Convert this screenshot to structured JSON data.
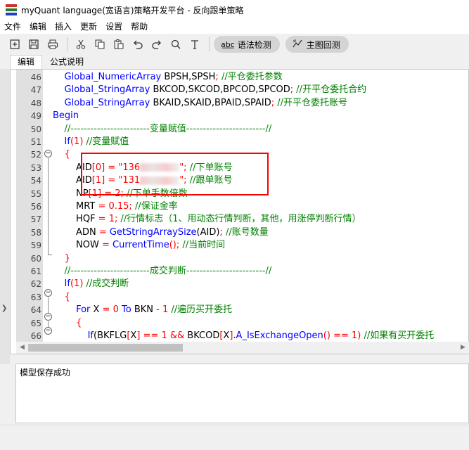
{
  "window": {
    "title": "myQuant language(宽语言)策略开发平台 - 反向跟单策略",
    "logo_colors": [
      "#d03030",
      "#2d7a2d",
      "#2040c0"
    ]
  },
  "menu": [
    "文件",
    "编辑",
    "插入",
    "更新",
    "设置",
    "帮助"
  ],
  "toolbar": {
    "icons": [
      "new-file-icon",
      "save-icon",
      "print-icon",
      "cut-icon",
      "copy-icon",
      "paste-icon",
      "undo-icon",
      "redo-icon",
      "search-icon",
      "text-icon"
    ],
    "syntax_check_label": "语法检测",
    "backtest_label": "主图回测"
  },
  "tabs": [
    "编辑",
    "公式说明"
  ],
  "code_lines": [
    {
      "n": "46",
      "segs": [
        [
          "    ",
          "tx"
        ],
        [
          "Global_NumericArray",
          "fn"
        ],
        [
          " BPSH,SPSH",
          "tx"
        ],
        [
          ";",
          "op"
        ],
        [
          " //平仓委托参数",
          "cm"
        ]
      ]
    },
    {
      "n": "47",
      "segs": [
        [
          "    ",
          "tx"
        ],
        [
          "Global_StringArray",
          "fn"
        ],
        [
          " BKCOD,SKCOD,BPCOD,SPCOD",
          "tx"
        ],
        [
          ";",
          "op"
        ],
        [
          " //开平仓委托合约",
          "cm"
        ]
      ]
    },
    {
      "n": "48",
      "segs": [
        [
          "    ",
          "tx"
        ],
        [
          "Global_StringArray",
          "fn"
        ],
        [
          " BKAID,SKAID,BPAID,SPAID",
          "tx"
        ],
        [
          ";",
          "op"
        ],
        [
          " //开平仓委托账号",
          "cm"
        ]
      ]
    },
    {
      "n": "49",
      "segs": [
        [
          "Begin",
          "kw"
        ]
      ]
    },
    {
      "n": "50",
      "segs": [
        [
          "    //------------------------变量赋值------------------------//",
          "cm"
        ]
      ]
    },
    {
      "n": "51",
      "segs": [
        [
          "    ",
          "tx"
        ],
        [
          "If",
          "kw"
        ],
        [
          "(",
          "op"
        ],
        [
          "1",
          "num"
        ],
        [
          ")",
          "op"
        ],
        [
          " //变量赋值",
          "cm"
        ]
      ]
    },
    {
      "n": "52",
      "segs": [
        [
          "    ",
          "tx"
        ],
        [
          "{",
          "op"
        ]
      ]
    },
    {
      "n": "53",
      "segs": [
        [
          "        AID",
          "tx"
        ],
        [
          "[",
          "op"
        ],
        [
          "0",
          "num"
        ],
        [
          "]",
          "op"
        ],
        [
          " = ",
          "op"
        ],
        [
          "\"136",
          "str"
        ],
        [
          "BLUR",
          "blur"
        ],
        [
          "\";",
          "str"
        ],
        [
          " //下单账号",
          "cm"
        ]
      ]
    },
    {
      "n": "54",
      "segs": [
        [
          "        AID",
          "tx"
        ],
        [
          "[",
          "op"
        ],
        [
          "1",
          "num"
        ],
        [
          "]",
          "op"
        ],
        [
          " = ",
          "op"
        ],
        [
          "\"131",
          "str"
        ],
        [
          "BLUR",
          "blur"
        ],
        [
          "\";",
          "str"
        ],
        [
          " //跟单账号",
          "cm"
        ]
      ]
    },
    {
      "n": "55",
      "segs": [
        [
          "        NP",
          "tx"
        ],
        [
          "[",
          "op"
        ],
        [
          "1",
          "num"
        ],
        [
          "]",
          "op"
        ],
        [
          " = ",
          "op"
        ],
        [
          "2",
          "num"
        ],
        [
          ";",
          "op"
        ],
        [
          " //下单手数倍数",
          "cm"
        ]
      ]
    },
    {
      "n": "56",
      "segs": [
        [
          "        MRT",
          "tx"
        ],
        [
          " = ",
          "op"
        ],
        [
          "0.15",
          "num"
        ],
        [
          ";",
          "op"
        ],
        [
          " //保证金率",
          "cm"
        ]
      ]
    },
    {
      "n": "57",
      "segs": [
        [
          "        HQF",
          "tx"
        ],
        [
          " = ",
          "op"
        ],
        [
          "1",
          "num"
        ],
        [
          ";",
          "op"
        ],
        [
          " //行情标志（1、用动态行情判断，其他，用涨停判断行情）",
          "cm"
        ]
      ]
    },
    {
      "n": "58",
      "segs": [
        [
          "        ADN",
          "tx"
        ],
        [
          " = ",
          "op"
        ],
        [
          "GetStringArraySize",
          "fn"
        ],
        [
          "(AID)",
          "tx"
        ],
        [
          ";",
          "op"
        ],
        [
          " //账号数量",
          "cm"
        ]
      ]
    },
    {
      "n": "59",
      "segs": [
        [
          "        NOW",
          "tx"
        ],
        [
          " = ",
          "op"
        ],
        [
          "CurrentTime",
          "fn"
        ],
        [
          "()",
          "op"
        ],
        [
          ";",
          "op"
        ],
        [
          " //当前时间",
          "cm"
        ]
      ]
    },
    {
      "n": "60",
      "segs": [
        [
          "    ",
          "tx"
        ],
        [
          "}",
          "op"
        ]
      ]
    },
    {
      "n": "61",
      "segs": [
        [
          "    //------------------------成交判断------------------------//",
          "cm"
        ]
      ]
    },
    {
      "n": "62",
      "segs": [
        [
          "    ",
          "tx"
        ],
        [
          "If",
          "kw"
        ],
        [
          "(",
          "op"
        ],
        [
          "1",
          "num"
        ],
        [
          ")",
          "op"
        ],
        [
          " //成交判断",
          "cm"
        ]
      ]
    },
    {
      "n": "63",
      "segs": [
        [
          "    ",
          "tx"
        ],
        [
          "{",
          "op"
        ]
      ]
    },
    {
      "n": "64",
      "segs": [
        [
          "        ",
          "tx"
        ],
        [
          "For",
          "kw"
        ],
        [
          " X",
          "tx"
        ],
        [
          " = ",
          "op"
        ],
        [
          "0",
          "num"
        ],
        [
          " To",
          "kw"
        ],
        [
          " BKN",
          "tx"
        ],
        [
          " - ",
          "op"
        ],
        [
          "1",
          "num"
        ],
        [
          " //遍历买开委托",
          "cm"
        ]
      ]
    },
    {
      "n": "65",
      "segs": [
        [
          "        ",
          "tx"
        ],
        [
          "{",
          "op"
        ]
      ]
    },
    {
      "n": "66",
      "segs": [
        [
          "            ",
          "tx"
        ],
        [
          "If",
          "kw"
        ],
        [
          "(BKFLG",
          "tx"
        ],
        [
          "[",
          "op"
        ],
        [
          "X",
          "tx"
        ],
        [
          "]",
          "op"
        ],
        [
          " == ",
          "op"
        ],
        [
          "1",
          "num"
        ],
        [
          " && ",
          "op"
        ],
        [
          "BKCOD",
          "tx"
        ],
        [
          "[",
          "op"
        ],
        [
          "X",
          "tx"
        ],
        [
          "]",
          "op"
        ],
        [
          ".",
          "tx"
        ],
        [
          "A_IsExchangeOpen",
          "fn"
        ],
        [
          "()",
          "op"
        ],
        [
          " == ",
          "op"
        ],
        [
          "1",
          "num"
        ],
        [
          ")",
          "op"
        ],
        [
          " //如果有买开委托",
          "cm"
        ]
      ]
    }
  ],
  "status_message": "模型保存成功"
}
